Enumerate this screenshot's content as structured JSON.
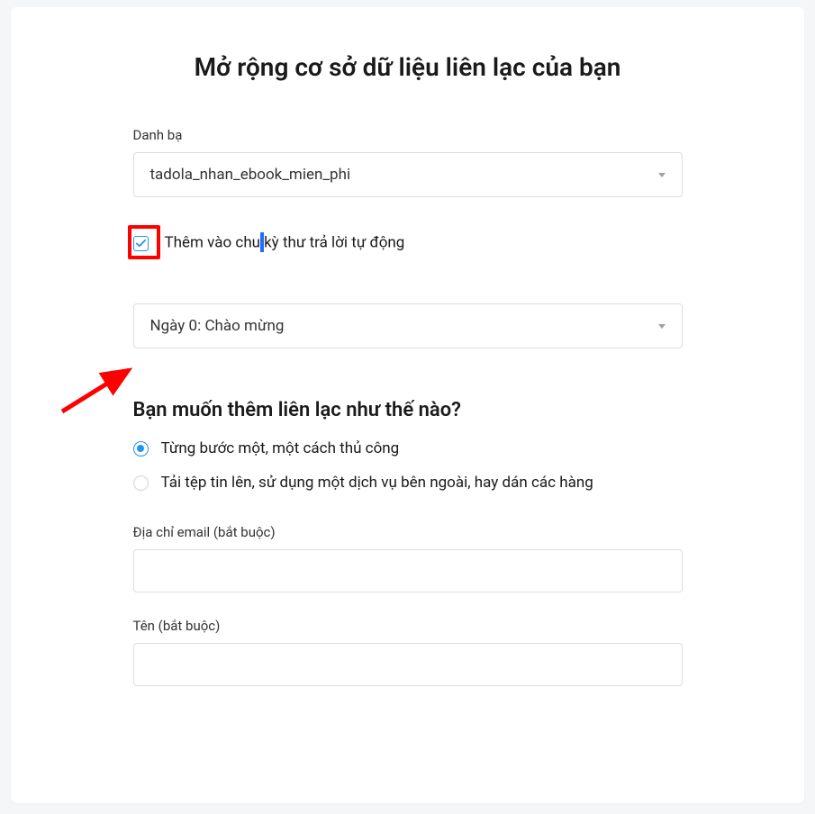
{
  "title": "Mở rộng cơ sở dữ liệu liên lạc của bạn",
  "contact_list": {
    "label": "Danh bạ",
    "selected": "tadola_nhan_ebook_mien_phi"
  },
  "autoresponder": {
    "checkbox_label_pre": "Thêm vào chu",
    "checkbox_label_post": "kỳ thư trả lời tự động",
    "checked": true,
    "cycle_selected": "Ngày 0: Chào mừng"
  },
  "how_add": {
    "heading": "Bạn muốn thêm liên lạc như thế nào?",
    "options": [
      {
        "label": "Từng bước một, một cách thủ công",
        "selected": true
      },
      {
        "label": "Tải tệp tin lên, sử dụng một dịch vụ bên ngoài, hay dán các hàng",
        "selected": false
      }
    ]
  },
  "fields": {
    "email_label": "Địa chỉ email (bắt buộc)",
    "name_label": "Tên (bắt buộc)"
  }
}
